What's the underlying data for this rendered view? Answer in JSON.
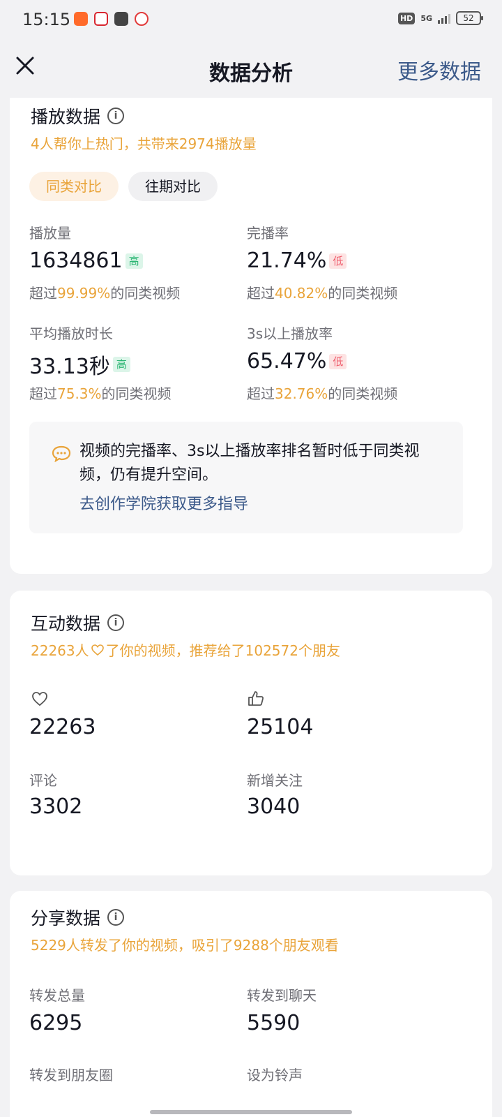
{
  "status_bar": {
    "time": "15:15",
    "hd": "HD",
    "network": "5G",
    "battery": "52"
  },
  "nav": {
    "title": "数据分析",
    "more": "更多数据"
  },
  "play": {
    "title": "播放数据",
    "subtitle": "4人帮你上热门，共带来2974播放量",
    "tabs": [
      "同类对比",
      "往期对比"
    ],
    "metrics": [
      {
        "label": "播放量",
        "value": "1634861",
        "tag": "高",
        "foot_prefix": "超过",
        "foot_pct": "99.99%",
        "foot_suffix": "的同类视频"
      },
      {
        "label": "完播率",
        "value": "21.74%",
        "tag": "低",
        "foot_prefix": "超过",
        "foot_pct": "40.82%",
        "foot_suffix": "的同类视频"
      },
      {
        "label": "平均播放时长",
        "value": "33.13秒",
        "tag": "高",
        "foot_prefix": "超过",
        "foot_pct": "75.3%",
        "foot_suffix": "的同类视频"
      },
      {
        "label": "3s以上播放率",
        "value": "65.47%",
        "tag": "低",
        "foot_prefix": "超过",
        "foot_pct": "32.76%",
        "foot_suffix": "的同类视频"
      }
    ],
    "tip_text": "视频的完播率、3s以上播放率排名暂时低于同类视频，仍有提升空间。",
    "tip_link": "去创作学院获取更多指导"
  },
  "interact": {
    "title": "互动数据",
    "subtitle_pre": "22263人",
    "subtitle_post": "了你的视频，推荐给了102572个朋友",
    "likes": "22263",
    "thumbs": "25104",
    "comments_label": "评论",
    "comments": "3302",
    "follows_label": "新增关注",
    "follows": "3040"
  },
  "share": {
    "title": "分享数据",
    "subtitle": "5229人转发了你的视频，吸引了9288个朋友观看",
    "items": [
      {
        "label": "转发总量",
        "value": "6295"
      },
      {
        "label": "转发到聊天",
        "value": "5590"
      },
      {
        "label": "转发到朋友圈",
        "value": ""
      },
      {
        "label": "设为铃声",
        "value": ""
      }
    ]
  },
  "colors": {
    "accent_orange": "#e9a43a",
    "link_blue": "#3c5a8a",
    "tag_high": "#2bb673",
    "tag_low": "#ef5d6c"
  }
}
